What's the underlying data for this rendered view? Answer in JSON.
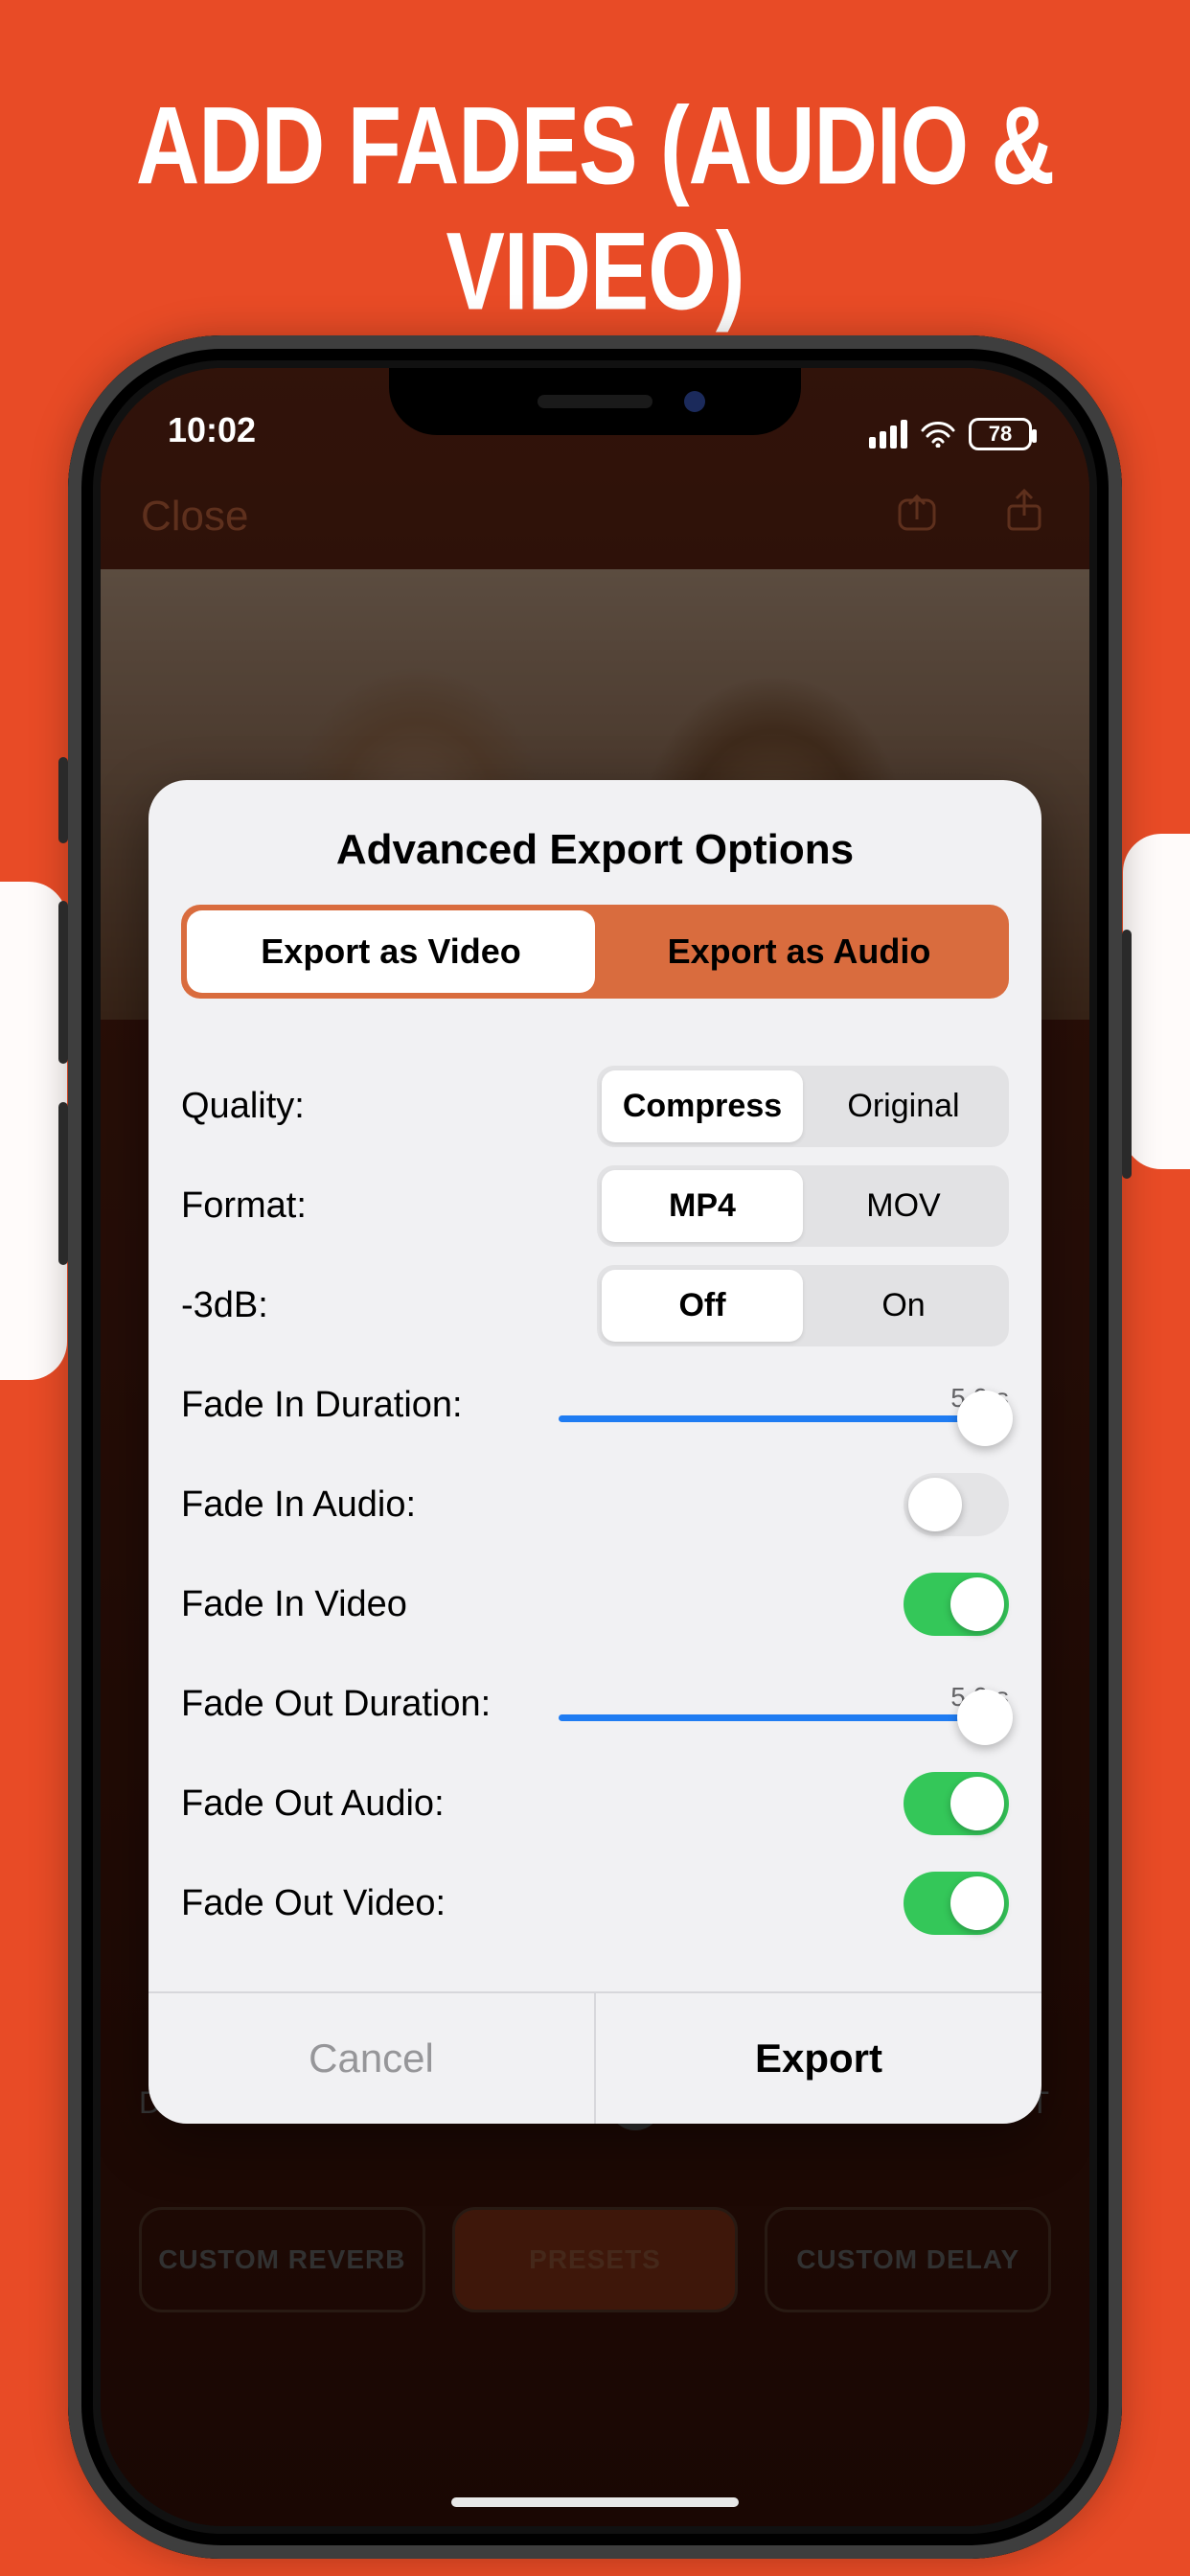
{
  "promo": {
    "title": "ADD FADES (AUDIO & VIDEO)"
  },
  "status": {
    "time": "10:02",
    "battery": "78"
  },
  "nav": {
    "close": "Close"
  },
  "modal": {
    "title": "Advanced Export Options",
    "top_seg": {
      "video": "Export as Video",
      "audio": "Export as Audio"
    },
    "quality": {
      "label": "Quality:",
      "opt_compress": "Compress",
      "opt_original": "Original"
    },
    "format": {
      "label": "Format:",
      "opt_mp4": "MP4",
      "opt_mov": "MOV"
    },
    "minus3db": {
      "label": "-3dB:",
      "opt_off": "Off",
      "opt_on": "On"
    },
    "fade_in_dur": {
      "label": "Fade In Duration:",
      "value": "5.0 s"
    },
    "fade_in_audio": {
      "label": "Fade In Audio:"
    },
    "fade_in_video": {
      "label": "Fade In Video"
    },
    "fade_out_dur": {
      "label": "Fade Out Duration:",
      "value": "5.0 s"
    },
    "fade_out_audio": {
      "label": "Fade Out Audio:"
    },
    "fade_out_video": {
      "label": "Fade Out Video:"
    },
    "cancel": "Cancel",
    "export": "Export"
  },
  "bottom": {
    "dry": "DRY",
    "wet": "WET",
    "btn_reverb": "CUSTOM REVERB",
    "btn_presets": "PRESETS",
    "btn_delay": "CUSTOM DELAY"
  }
}
